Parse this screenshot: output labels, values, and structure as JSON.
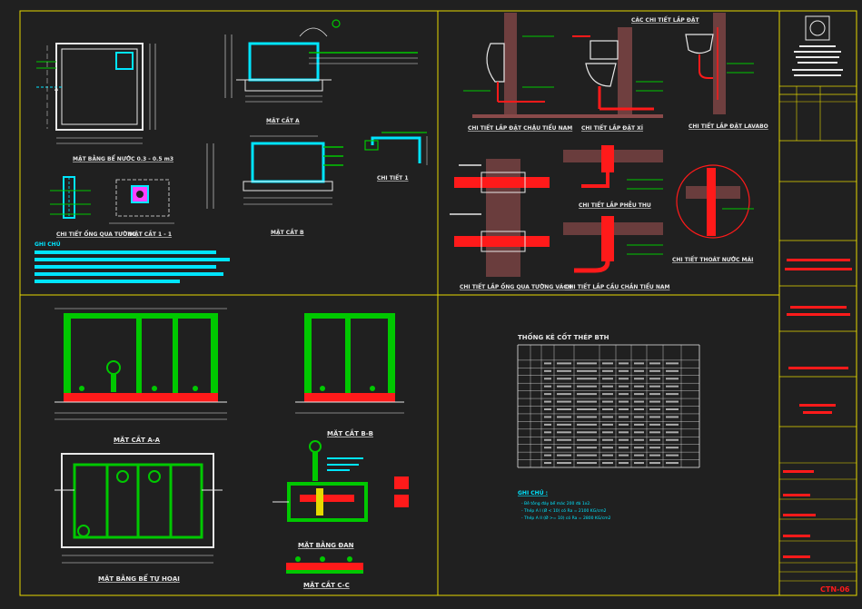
{
  "colors": {
    "background": "#202020",
    "frame": "#e6d900",
    "cyan": "#00e5ff",
    "green": "#00c800",
    "red": "#ff1a1a",
    "white": "#e8e8e8",
    "magenta": "#ff40ff",
    "hatch": "#8a4a4a"
  },
  "panel_tl": {
    "plan_septic_label": "MẶT BẰNG BỂ NƯỚC 0.3 - 0.5 m3",
    "section_a_label": "MẶT CẮT A",
    "section_b_label": "MẶT CẮT B",
    "detail_label": "CHI TIẾT 1",
    "vent_pipe_label": "CHI TIẾT ỐNG QUA TƯỜNG",
    "section_1_label": "MẶT CẮT 1 - 1",
    "notes_label": "GHI CHÚ"
  },
  "panel_tr": {
    "title": "CÁC CHI TIẾT LẮP ĐẶT",
    "urinal_label": "CHI TIẾT LẮP ĐẶT CHẬU TIỂU NAM",
    "toilet_label": "CHI TIẾT LẮP ĐẶT XÍ",
    "lavabo_label": "CHI TIẾT LẮP ĐẶT LAVABO",
    "wall_pipe_label": "CHI TIẾT LẮP ỐNG QUA TƯỜNG VÁCH",
    "floor_drain_label": "CHI TIẾT LẮP PHỄU THU",
    "floor_drain_2_label": "CHI TIẾT LẮP CẦU CHẮN TIỂU NAM",
    "roof_drain_label": "CHI TIẾT THOÁT NƯỚC MÁI"
  },
  "panel_bl": {
    "section_aa_label": "MẶT CẮT A-A",
    "section_bb_label": "MẶT CẮT B-B",
    "tank_plan_label": "MẶT BẰNG BỂ TỰ HOẠI",
    "base_plan_label": "MẶT BẰNG ĐAN",
    "section_cc_label": "MẶT CẮT C-C"
  },
  "panel_br": {
    "table_title": "THỐNG KÊ CỐT THÉP BTH",
    "notes_title": "GHI CHÚ :",
    "note_lines": [
      "- Bê tông đáy bể mác 200 đá 1x2.",
      "- Thép A I (Ø < 10) có Ra = 2100 KG/cm2",
      "- Thép A II (Ø >= 10) có Ra = 2800 KG/cm2"
    ]
  },
  "title_block": {
    "sheet_code": "CTN-06"
  }
}
